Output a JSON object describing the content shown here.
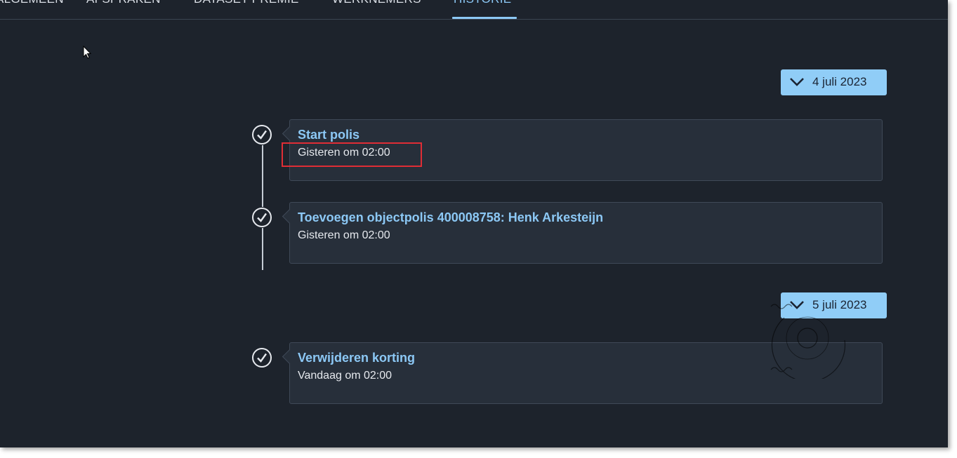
{
  "tabs": [
    {
      "label": "ALGEMEEN"
    },
    {
      "label": "AFSPRAKEN"
    },
    {
      "label": "DATASET PREMIE"
    },
    {
      "label": "WERKNEMERS"
    },
    {
      "label": "HISTORIE",
      "active": true
    }
  ],
  "groups": [
    {
      "date_label": "4 juli 2023",
      "events": [
        {
          "title": "Start polis",
          "time": "Gisteren om 02:00",
          "icon": "check-circle-icon"
        },
        {
          "title": "Toevoegen objectpolis 400008758: Henk Arkesteijn",
          "time": "Gisteren om 02:00",
          "icon": "check-circle-icon"
        }
      ]
    },
    {
      "date_label": "5 juli 2023",
      "events": [
        {
          "title": "Verwijderen korting",
          "time": "Vandaag om 02:00",
          "icon": "check-circle-icon"
        }
      ]
    }
  ],
  "colors": {
    "background": "#1d232c",
    "card": "#272f3a",
    "accent": "#8cc8f5",
    "date_button": "#90cdf7",
    "highlight": "#e02d35"
  }
}
